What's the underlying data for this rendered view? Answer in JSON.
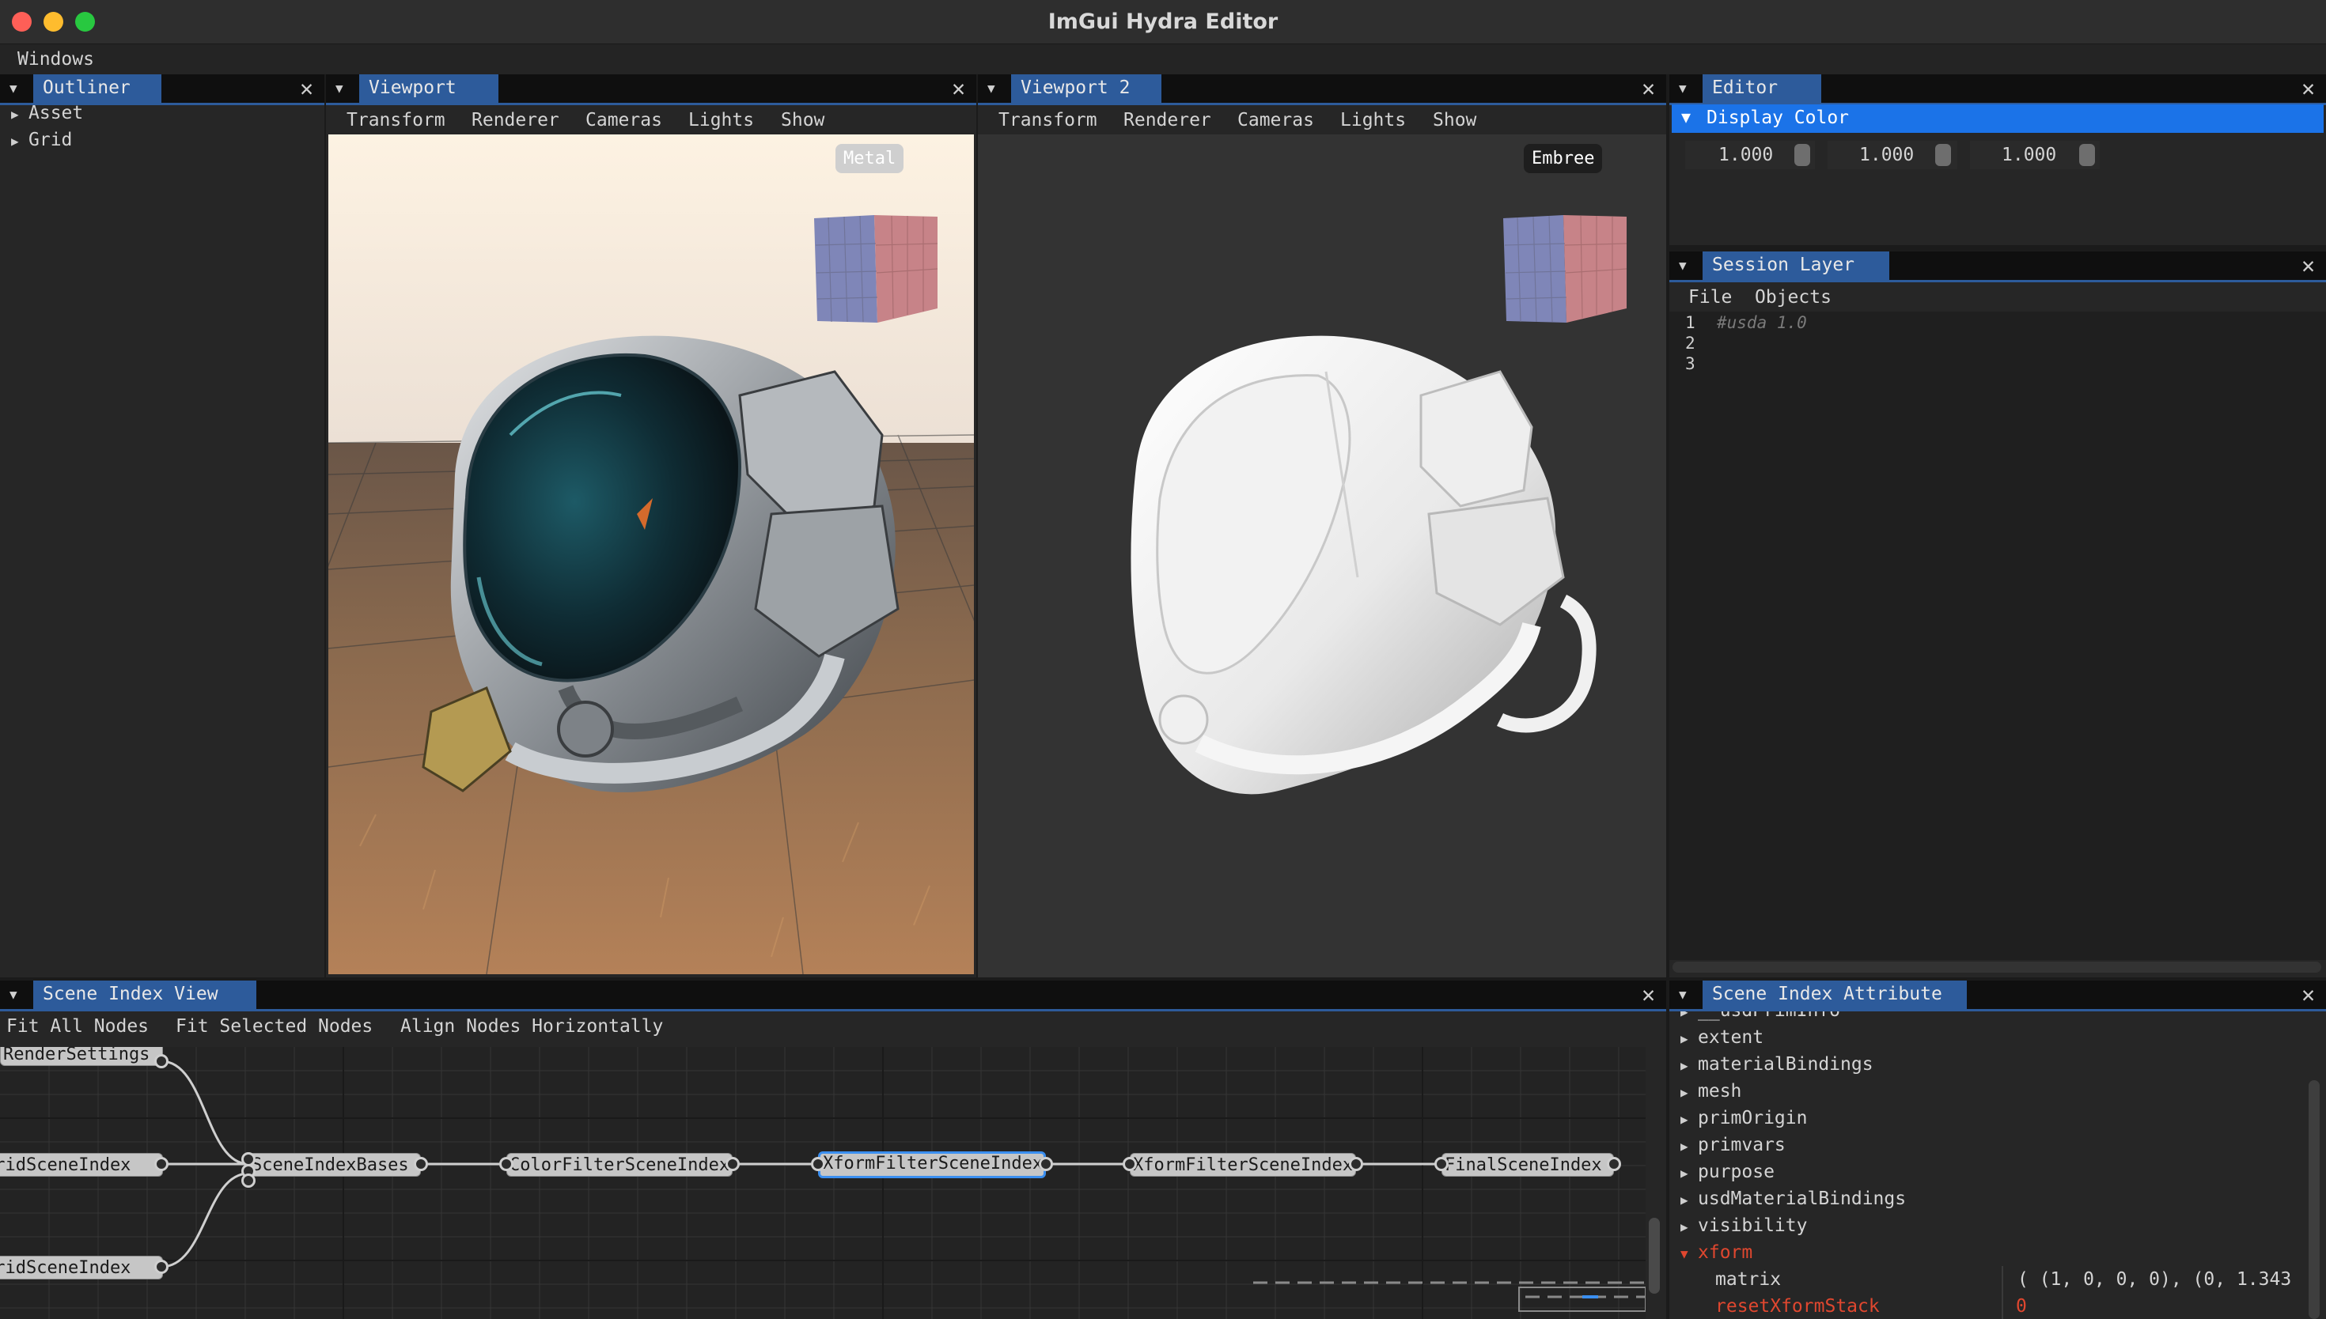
{
  "window": {
    "title": "ImGui Hydra Editor"
  },
  "menubar": {
    "windows": "Windows"
  },
  "outliner": {
    "title": "Outliner",
    "items": [
      {
        "label": "Asset"
      },
      {
        "label": "Grid"
      }
    ]
  },
  "viewport1": {
    "title": "Viewport",
    "menu": [
      "Transform",
      "Renderer",
      "Cameras",
      "Lights",
      "Show"
    ],
    "renderer_badge": "Metal"
  },
  "viewport2": {
    "title": "Viewport 2",
    "menu": [
      "Transform",
      "Renderer",
      "Cameras",
      "Lights",
      "Show"
    ],
    "renderer_badge": "Embree"
  },
  "editor": {
    "title": "Editor",
    "section": "Display Color",
    "values": [
      "1.000",
      "1.000",
      "1.000"
    ]
  },
  "session_layer": {
    "title": "Session Layer",
    "menu": [
      "File",
      "Objects"
    ],
    "line_numbers": [
      "1",
      "2",
      "3"
    ],
    "code_line1": "#usda 1.0"
  },
  "scene_index_view": {
    "title": "Scene Index View",
    "toolbar": [
      "Fit All Nodes",
      "Fit Selected Nodes",
      "Align Nodes Horizontally"
    ],
    "nodes": {
      "render_settings": "RenderSettings",
      "grid_top": "GridSceneIndex",
      "grid_bottom": "GridSceneIndex",
      "bases": "SceneIndexBases",
      "color_filter": "ColorFilterSceneIndex",
      "xform_filter_1": "XformFilterSceneIndex",
      "xform_filter_2": "XformFilterSceneIndex",
      "final": "FinalSceneIndex"
    }
  },
  "scene_index_attribute": {
    "title": "Scene Index Attribute",
    "partial_top": "__usdPrimInfo",
    "items": [
      "extent",
      "materialBindings",
      "mesh",
      "primOrigin",
      "primvars",
      "purpose",
      "usdMaterialBindings",
      "visibility"
    ],
    "expanded": "xform",
    "rows": [
      {
        "key": "matrix",
        "value": "( (1, 0, 0, 0), (0, 1.343"
      },
      {
        "key": "resetXformStack",
        "value": "0"
      }
    ]
  },
  "colors": {
    "accent_tab": "#2d5b9b",
    "selection": "#1b73e8",
    "node_selected_border": "#3b8ff0",
    "expanded_red": "#e0472f",
    "traffic_close": "#fe5f57",
    "traffic_min": "#febc2e",
    "traffic_max": "#28c840"
  },
  "icons": [
    "close-icon",
    "collapse-triangle-icon",
    "tree-arrow-right-icon",
    "tree-arrow-down-icon",
    "view-cube-icon",
    "slider-grab-icon"
  ]
}
